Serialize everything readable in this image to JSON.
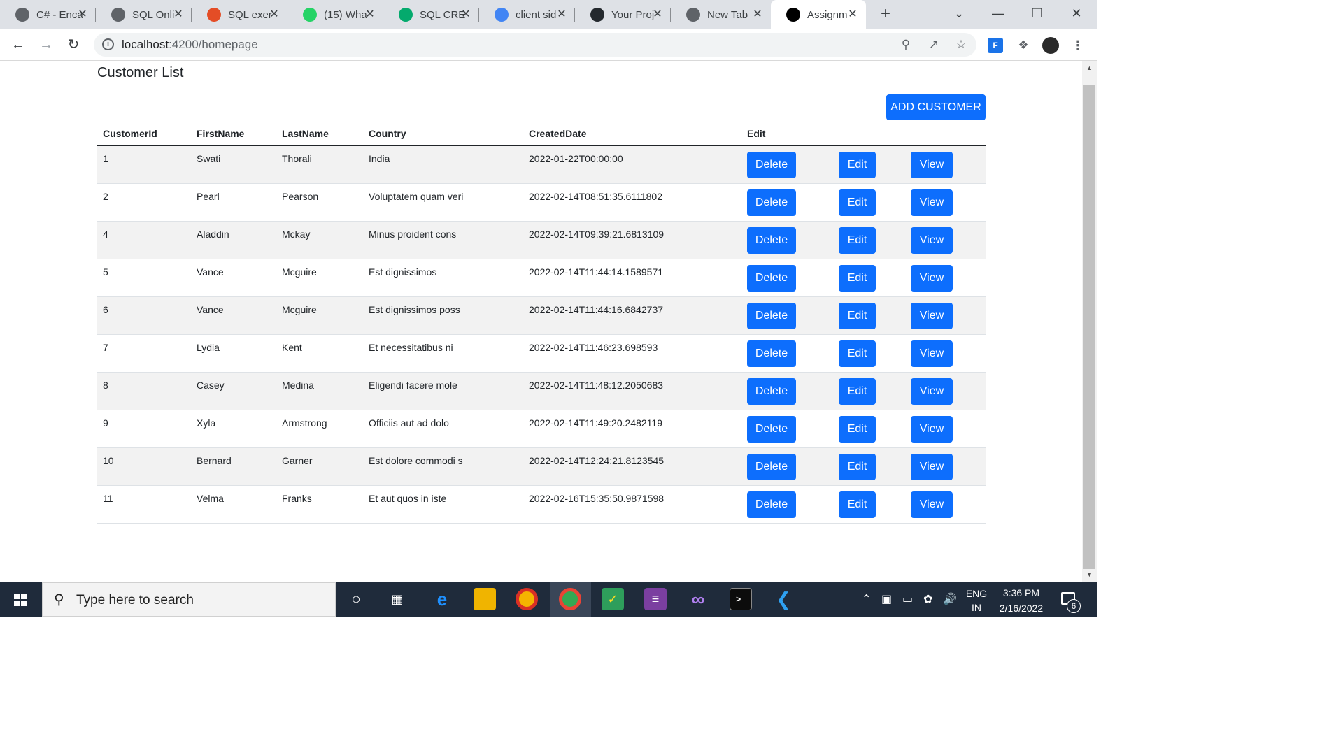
{
  "browser": {
    "tabs": [
      {
        "title": "C# - Enca",
        "icon": "diamond-icon",
        "color": "#5f6368"
      },
      {
        "title": "SQL Onli",
        "icon": "diamond-icon",
        "color": "#5f6368"
      },
      {
        "title": "SQL exer",
        "icon": "w3r-icon",
        "color": "#e44d26"
      },
      {
        "title": "(15) Wha",
        "icon": "whatsapp-icon",
        "color": "#25d366"
      },
      {
        "title": "SQL CRE",
        "icon": "w3schools-icon",
        "color": "#04aa6d"
      },
      {
        "title": "client sid",
        "icon": "google-icon",
        "color": "#4285f4"
      },
      {
        "title": "Your Proj",
        "icon": "github-icon",
        "color": "#24292e"
      },
      {
        "title": "New Tab",
        "icon": "chrome-icon",
        "color": "#5f6368"
      },
      {
        "title": "Assignm",
        "icon": "angular-icon",
        "color": "#000000"
      }
    ],
    "url_host": "localhost",
    "url_path": ":4200/homepage"
  },
  "page": {
    "title": "Customer List",
    "add_button": "ADD CUSTOMER",
    "columns": [
      "CustomerId",
      "FirstName",
      "LastName",
      "Country",
      "CreatedDate",
      "Edit"
    ],
    "actions": {
      "delete": "Delete",
      "edit": "Edit",
      "view": "View"
    },
    "rows": [
      {
        "id": "1",
        "first": "Swati",
        "last": "Thorali",
        "country": "India",
        "created": "2022-01-22T00:00:00"
      },
      {
        "id": "2",
        "first": "Pearl",
        "last": "Pearson",
        "country": "Voluptatem quam veri",
        "created": "2022-02-14T08:51:35.6111802"
      },
      {
        "id": "4",
        "first": "Aladdin",
        "last": "Mckay",
        "country": "Minus proident cons",
        "created": "2022-02-14T09:39:21.6813109"
      },
      {
        "id": "5",
        "first": "Vance",
        "last": "Mcguire",
        "country": "Est dignissimos",
        "created": "2022-02-14T11:44:14.1589571"
      },
      {
        "id": "6",
        "first": "Vance",
        "last": "Mcguire",
        "country": "Est dignissimos poss",
        "created": "2022-02-14T11:44:16.6842737"
      },
      {
        "id": "7",
        "first": "Lydia",
        "last": "Kent",
        "country": "Et necessitatibus ni",
        "created": "2022-02-14T11:46:23.698593"
      },
      {
        "id": "8",
        "first": "Casey",
        "last": "Medina",
        "country": "Eligendi facere mole",
        "created": "2022-02-14T11:48:12.2050683"
      },
      {
        "id": "9",
        "first": "Xyla",
        "last": "Armstrong",
        "country": "Officiis aut ad dolo",
        "created": "2022-02-14T11:49:20.2482119"
      },
      {
        "id": "10",
        "first": "Bernard",
        "last": "Garner",
        "country": "Est dolore commodi s",
        "created": "2022-02-14T12:24:21.8123545"
      },
      {
        "id": "11",
        "first": "Velma",
        "last": "Franks",
        "country": "Et aut quos in iste",
        "created": "2022-02-16T15:35:50.9871598"
      }
    ]
  },
  "taskbar": {
    "search_placeholder": "Type here to search",
    "lang_top": "ENG",
    "lang_bottom": "IN",
    "time": "3:36 PM",
    "date": "2/16/2022",
    "notification_count": "6"
  },
  "colors": {
    "primary": "#0d6efd",
    "stripe": "#f2f2f2",
    "taskbar": "#1f2b3b"
  }
}
